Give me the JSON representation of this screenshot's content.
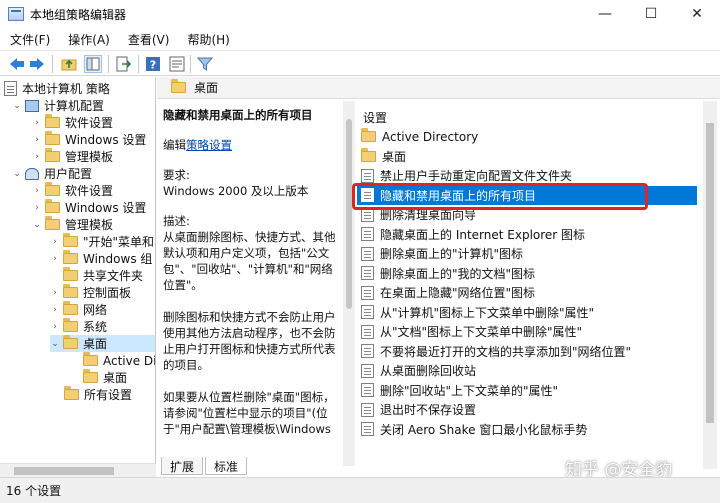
{
  "window": {
    "title": "本地组策略编辑器",
    "minimize": "—",
    "maximize": "☐",
    "close": "✕"
  },
  "menu": [
    "文件(F)",
    "操作(A)",
    "查看(V)",
    "帮助(H)"
  ],
  "tree": {
    "root": "本地计算机 策略",
    "computer_config": "计算机配置",
    "cc_software": "软件设置",
    "cc_windows": "Windows 设置",
    "cc_admin": "管理模板",
    "user_config": "用户配置",
    "uc_software": "软件设置",
    "uc_windows": "Windows 设置",
    "uc_admin": "管理模板",
    "start_menu": "\"开始\"菜单和",
    "windows_comp": "Windows 组",
    "shared_folders": "共享文件夹",
    "control_panel": "控制面板",
    "network": "网络",
    "system": "系统",
    "desktop": "桌面",
    "active_dir": "Active Di",
    "desktop_sub": "桌面",
    "all_settings": "所有设置"
  },
  "pane": {
    "header": "桌面",
    "desc_title": "隐藏和禁用桌面上的所有项目",
    "edit_prefix": "编辑",
    "edit_link": "策略设置",
    "req_label": "要求:",
    "req_value": "Windows 2000 及以上版本",
    "desc_label": "描述:",
    "desc_text": "从桌面删除图标、快捷方式、其他默认项和用户定义项，包括\"公文包\"、\"回收站\"、\"计算机\"和\"网络位置\"。",
    "desc_text2": "删除图标和快捷方式不会防止用户使用其他方法启动程序，也不会防止用户打开图标和快捷方式所代表的项目。",
    "desc_text3": "如果要从位置栏删除\"桌面\"图标，请参阅\"位置栏中显示的项目\"(位于\"用户配置\\管理模板\\Windows 组件\\通用打开文件对话框\")。这将"
  },
  "settings": {
    "header": "设置",
    "items": [
      "Active Directory",
      "桌面",
      "禁止用户手动重定向配置文件文件夹",
      "隐藏和禁用桌面上的所有项目",
      "删除清理桌面向导",
      "隐藏桌面上的 Internet Explorer 图标",
      "删除桌面上的\"计算机\"图标",
      "删除桌面上的\"我的文档\"图标",
      "在桌面上隐藏\"网络位置\"图标",
      "从\"计算机\"图标上下文菜单中删除\"属性\"",
      "从\"文档\"图标上下文菜单中删除\"属性\"",
      "不要将最近打开的文档的共享添加到\"网络位置\"",
      "从桌面删除回收站",
      "删除\"回收站\"上下文菜单的\"属性\"",
      "退出时不保存设置",
      "关闭 Aero Shake 窗口最小化鼠标手势"
    ]
  },
  "tabs": [
    "扩展",
    "标准"
  ],
  "status": "16 个设置",
  "watermark": "知乎 @安全豹"
}
